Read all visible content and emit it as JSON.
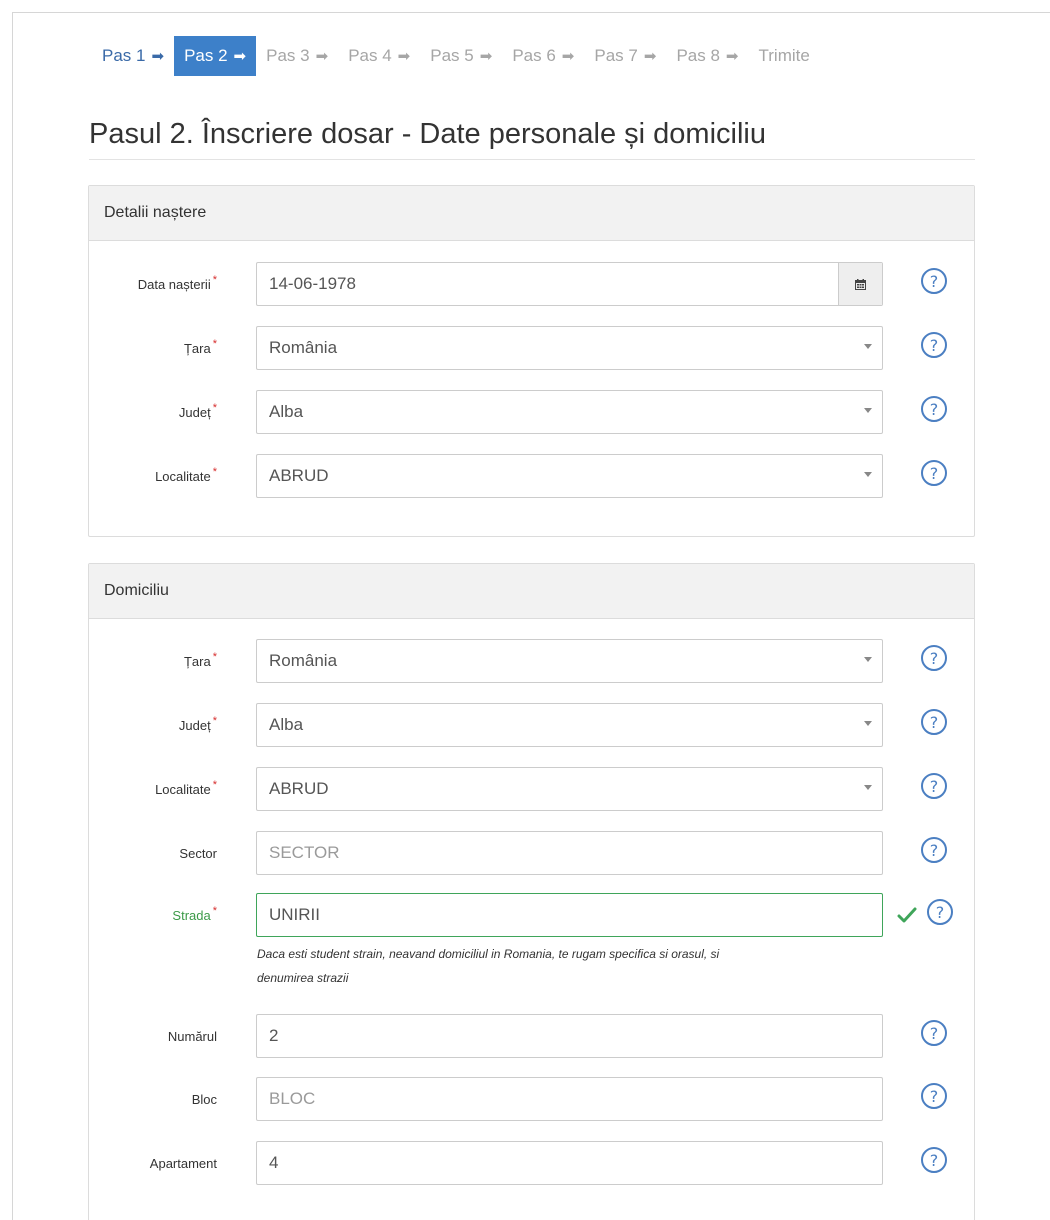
{
  "steps": [
    {
      "label": "Pas 1",
      "state": "done"
    },
    {
      "label": "Pas 2",
      "state": "active"
    },
    {
      "label": "Pas 3",
      "state": "todo"
    },
    {
      "label": "Pas 4",
      "state": "todo"
    },
    {
      "label": "Pas 5",
      "state": "todo"
    },
    {
      "label": "Pas 6",
      "state": "todo"
    },
    {
      "label": "Pas 7",
      "state": "todo"
    },
    {
      "label": "Pas 8",
      "state": "todo"
    },
    {
      "label": "Trimite",
      "state": "todo"
    }
  ],
  "page_title": "Pasul 2. Înscriere dosar - Date personale și domiciliu",
  "birth": {
    "heading": "Detalii naștere",
    "date_label": "Data nașterii",
    "date_value": "14-06-1978",
    "country_label": "Țara",
    "country_value": "România",
    "county_label": "Județ",
    "county_value": "Alba",
    "locality_label": "Localitate",
    "locality_value": "ABRUD"
  },
  "domicile": {
    "heading": "Domiciliu",
    "country_label": "Țara",
    "country_value": "România",
    "county_label": "Județ",
    "county_value": "Alba",
    "locality_label": "Localitate",
    "locality_value": "ABRUD",
    "sector_label": "Sector",
    "sector_placeholder": "SECTOR",
    "street_label": "Strada",
    "street_value": "UNIRII",
    "street_hint_line1": "Daca esti student strain, neavand domiciliul in Romania, te rugam specifica si orasul, si",
    "street_hint_line2": "denumirea strazii",
    "number_label": "Numărul",
    "number_value": "2",
    "block_label": "Bloc",
    "block_placeholder": "BLOC",
    "apartment_label": "Apartament",
    "apartment_value": "4"
  },
  "required_mark": "*",
  "help_glyph": "?",
  "colors": {
    "active_step": "#3d80c9",
    "done_step": "#3a6aa8",
    "success": "#3fa55a",
    "required": "#d62d2d",
    "help": "#4b7fc2"
  }
}
